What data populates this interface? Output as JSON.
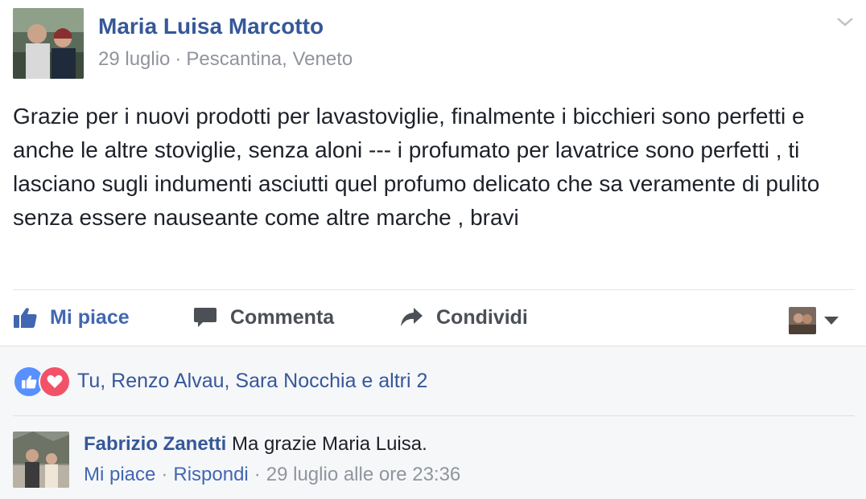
{
  "post": {
    "author": "Maria Luisa Marcotto",
    "date": "29 luglio",
    "separator": "·",
    "location": "Pescantina, Veneto",
    "text": "Grazie per i nuovi prodotti per lavastoviglie, finalmente i bicchieri sono perfetti e anche le altre stoviglie, senza aloni --- i profumato per lavatrice sono perfetti , ti lasciano sugli indumenti asciutti quel profumo delicato che sa veramente di pulito senza essere nauseante come altre marche , bravi"
  },
  "actions": {
    "like": "Mi piace",
    "comment": "Commenta",
    "share": "Condividi"
  },
  "reactions": {
    "names": "Tu, Renzo Alvau, Sara Nocchia e altri 2"
  },
  "comment": {
    "author": "Fabrizio Zanetti",
    "text": "Ma grazie Maria Luisa.",
    "like": "Mi piace",
    "separator": "·",
    "reply": "Rispondi",
    "timestamp": "29 luglio alle ore 23:36"
  },
  "colors": {
    "link": "#365899",
    "accent": "#4267b2",
    "meta": "#90949c",
    "like_reaction": "#5890ff",
    "love_reaction": "#f25268"
  },
  "icons": [
    "thumbs-up-icon",
    "comment-bubble-icon",
    "share-arrow-icon",
    "chevron-down-icon",
    "dropdown-triangle-icon",
    "like-reaction-icon",
    "love-reaction-icon"
  ]
}
